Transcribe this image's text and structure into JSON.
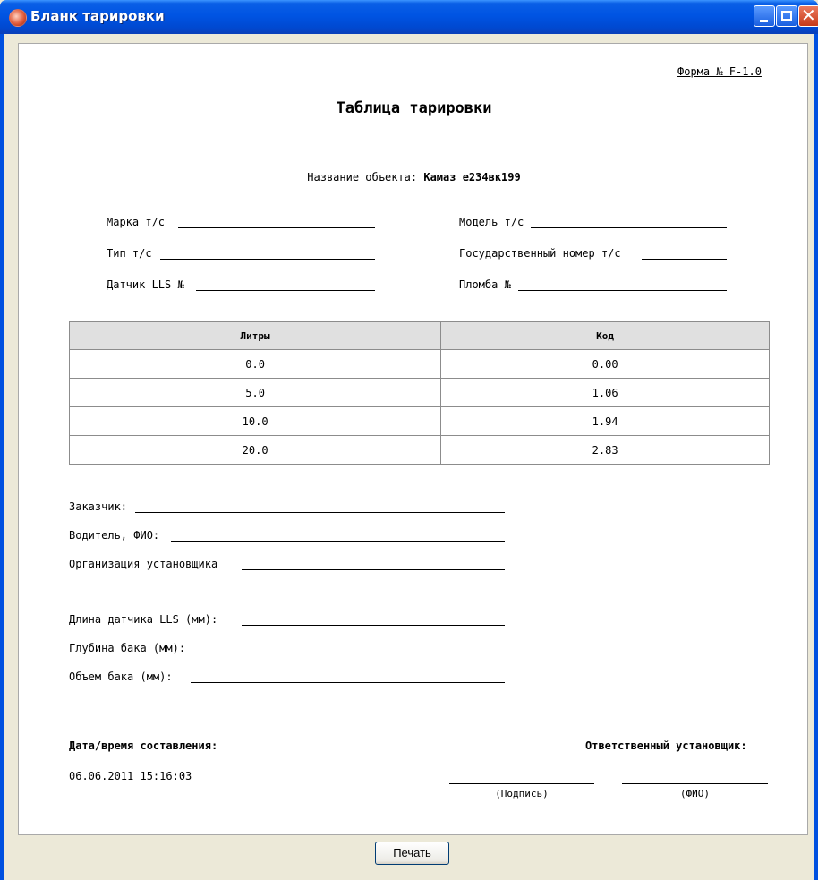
{
  "window": {
    "title": "Бланк тарировки",
    "controls": {
      "minimize": "minimize-icon",
      "maximize": "maximize-icon",
      "close": "close-icon"
    }
  },
  "document": {
    "form_number": "Форма № F-1.0",
    "title": "Таблица тарировки",
    "object_label": "Название объекта:",
    "object_value": "Камаз е234вк199",
    "fields_left": [
      {
        "label": "Марка т/с"
      },
      {
        "label": "Тип т/с"
      },
      {
        "label": "Датчик LLS №"
      }
    ],
    "fields_right": [
      {
        "label": "Модель т/с"
      },
      {
        "label": "Государственный номер т/с"
      },
      {
        "label": "Пломба №"
      }
    ],
    "table": {
      "headers": [
        "Литры",
        "Код"
      ],
      "rows": [
        [
          "0.0",
          "0.00"
        ],
        [
          "5.0",
          "1.06"
        ],
        [
          "10.0",
          "1.94"
        ],
        [
          "20.0",
          "2.83"
        ]
      ]
    },
    "fields_people": [
      {
        "label": "Заказчик:"
      },
      {
        "label": "Водитель, ФИО:"
      },
      {
        "label": "Организация установщика"
      }
    ],
    "fields_sensor": [
      {
        "label": "Длина датчика LLS (мм):"
      },
      {
        "label": "Глубина бака (мм):"
      },
      {
        "label": "Объем бака (мм):"
      }
    ],
    "datetime_label": "Дата/время составления:",
    "datetime_value": "06.06.2011 15:16:03",
    "responsible_label": "Ответственный установщик:",
    "signature_caption": "(Подпись)",
    "name_caption": "(ФИО)"
  },
  "footer": {
    "print_button": "Печать"
  }
}
